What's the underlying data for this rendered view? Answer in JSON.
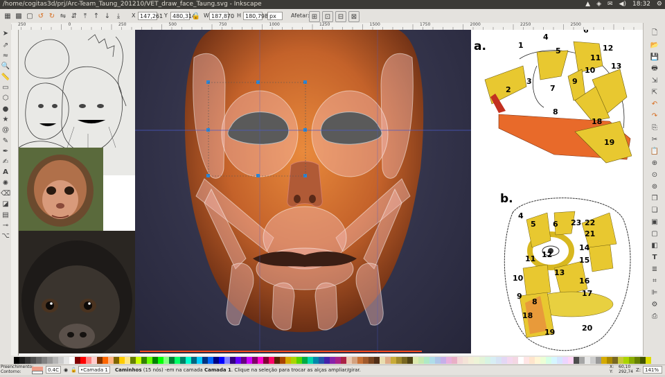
{
  "window": {
    "title": "/home/cogitas3d/prj/Arc-Team_Taung_201210/VET_draw_face_Taung.svg - Inkscape",
    "clock": "18:32",
    "volume_icon": "speaker-icon",
    "mail_icon": "envelope-icon",
    "network_icon": "wifi-icon"
  },
  "toolbar": {
    "x_label": "X",
    "x_value": "147,261",
    "y_label": "Y",
    "y_value": "480,314",
    "w_label": "W",
    "w_value": "187,870",
    "h_label": "H",
    "h_value": "180,798",
    "unit": "px",
    "affect_label": "Afetar:"
  },
  "ruler": {
    "ticks": [
      "250",
      "0",
      "250",
      "500",
      "750",
      "1000",
      "1250",
      "1500",
      "1750",
      "2000",
      "2250",
      "2500"
    ]
  },
  "figure": {
    "label_a": "a.",
    "label_b": "b.",
    "muscles_a": [
      "1",
      "2",
      "3",
      "4",
      "5",
      "6",
      "7",
      "8",
      "9",
      "10",
      "11",
      "12",
      "13",
      "18",
      "19"
    ],
    "muscles_b": [
      "4",
      "5",
      "6",
      "23",
      "22",
      "21",
      "14",
      "12",
      "11",
      "15",
      "13",
      "16",
      "10",
      "17",
      "9",
      "8",
      "18",
      "19",
      "20"
    ]
  },
  "status": {
    "fill_label": "Preenchimento:",
    "stroke_label": "Contorno:",
    "stroke_value": "0.4C",
    "layer": "•Camada 1",
    "message_bold": "Caminhos",
    "message_nodes": " (15 nós) -em na camada ",
    "message_layer": "Camada 1",
    "message_rest": ". Clique na seleção para trocar as alças ampliar/girar.",
    "x_coord": "60,10",
    "y_coord": "292,74",
    "zoom_label": "Z:",
    "zoom": "141%"
  }
}
